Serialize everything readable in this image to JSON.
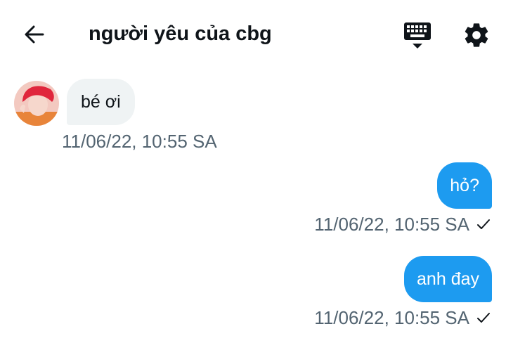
{
  "header": {
    "title": "người yêu của cbg",
    "back_icon": "arrow-left-icon",
    "keyboard_icon": "keyboard-icon",
    "settings_icon": "gear-icon"
  },
  "messages": [
    {
      "direction": "incoming",
      "text": "bé ơi",
      "timestamp": "11/06/22, 10:55 SA"
    },
    {
      "direction": "outgoing",
      "text": "hỏ?",
      "timestamp": "11/06/22, 10:55 SA",
      "status_icon": "check-icon"
    },
    {
      "direction": "outgoing",
      "text": "anh đay",
      "timestamp": "11/06/22, 10:55 SA",
      "status_icon": "check-icon"
    }
  ],
  "colors": {
    "accent": "#1d9bf0",
    "incoming_bubble": "#eff3f4",
    "timestamp": "#536471",
    "text": "#0f1419"
  }
}
